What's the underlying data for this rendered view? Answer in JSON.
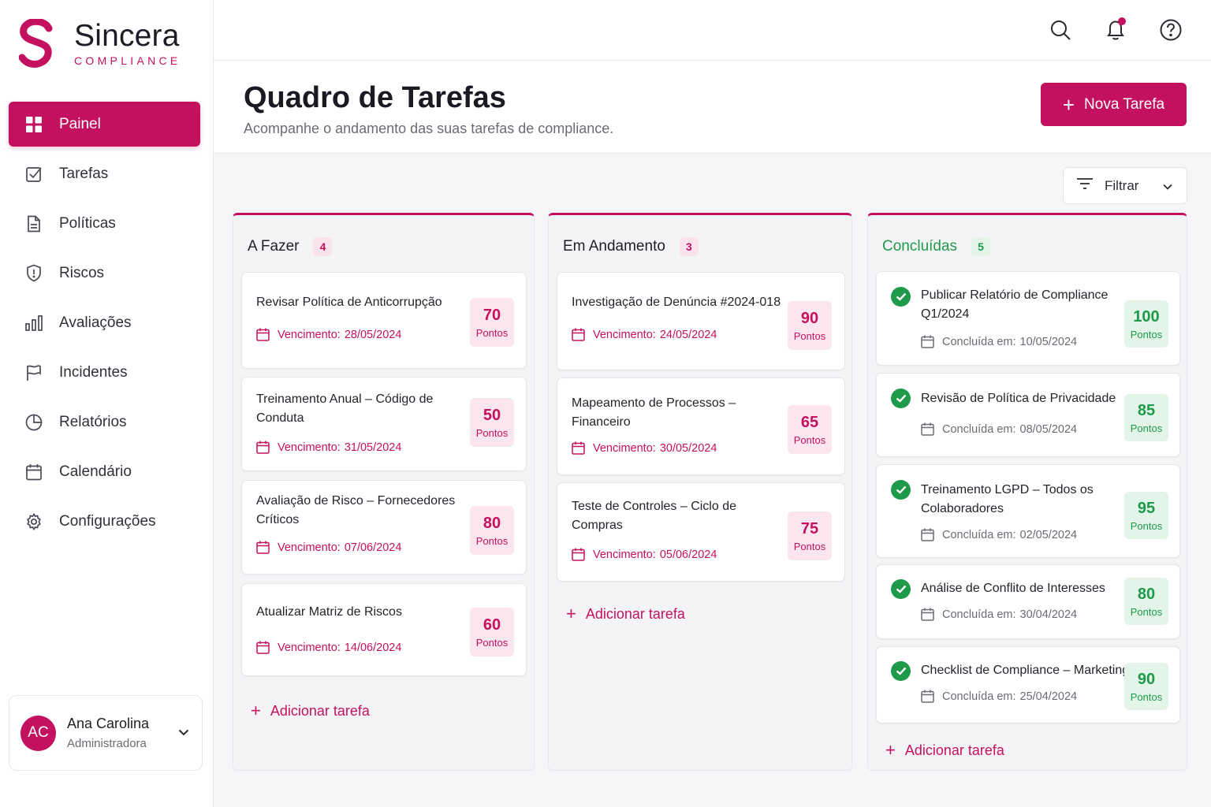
{
  "brand": {
    "name": "Sincera",
    "subtitle": "COMPLIANCE"
  },
  "nav": [
    {
      "label": "Painel",
      "icon": "dashboard-icon",
      "active": true
    },
    {
      "label": "Tarefas",
      "icon": "checkbox-icon"
    },
    {
      "label": "Políticas",
      "icon": "document-icon"
    },
    {
      "label": "Riscos",
      "icon": "shield-icon"
    },
    {
      "label": "Avaliações",
      "icon": "bar-chart-icon"
    },
    {
      "label": "Incidentes",
      "icon": "flag-icon"
    },
    {
      "label": "Relatórios",
      "icon": "pie-chart-icon"
    },
    {
      "label": "Calendário",
      "icon": "calendar-icon"
    },
    {
      "label": "Configurações",
      "icon": "gear-icon"
    }
  ],
  "user": {
    "initials": "AC",
    "name": "Ana Carolina",
    "role": "Administradora"
  },
  "header": {
    "title": "Quadro de Tarefas",
    "subtitle": "Acompanhe o andamento das suas tarefas de compliance.",
    "new_task_label": "Nova Tarefa",
    "filter_label": "Filtrar"
  },
  "colors": {
    "accent": "#c4115f",
    "success": "#1f9a4a"
  },
  "columns": [
    {
      "title": "A Fazer",
      "count": "4",
      "date_label": "Vencimento:",
      "add_label": "Adicionar tarefa",
      "cards": [
        {
          "title": "Revisar Política de Anticorrupção",
          "date": "28/05/2024",
          "points": "70",
          "points_label": "Pontos"
        },
        {
          "title": "Treinamento Anual – Código de Conduta",
          "date": "31/05/2024",
          "points": "50",
          "points_label": "Pontos"
        },
        {
          "title": "Avaliação de Risco – Fornecedores Críticos",
          "date": "07/06/2024",
          "points": "80",
          "points_label": "Pontos"
        },
        {
          "title": "Atualizar Matriz de Riscos",
          "date": "14/06/2024",
          "points": "60",
          "points_label": "Pontos"
        }
      ]
    },
    {
      "title": "Em Andamento",
      "count": "3",
      "date_label": "Vencimento:",
      "add_label": "Adicionar tarefa",
      "cards": [
        {
          "title": "Investigação de Denúncia #2024-018",
          "date": "24/05/2024",
          "points": "90",
          "points_label": "Pontos"
        },
        {
          "title": "Mapeamento de Processos – Financeiro",
          "date": "30/05/2024",
          "points": "65",
          "points_label": "Pontos"
        },
        {
          "title": "Teste de Controles – Ciclo de Compras",
          "date": "05/06/2024",
          "points": "75",
          "points_label": "Pontos"
        }
      ]
    },
    {
      "title": "Concluídas",
      "count": "5",
      "date_label": "Concluída em:",
      "add_label": "Adicionar tarefa",
      "cards": [
        {
          "title": "Publicar Relatório de Compliance Q1/2024",
          "date": "10/05/2024",
          "points": "100",
          "points_label": "Pontos"
        },
        {
          "title": "Revisão de Política de Privacidade",
          "date": "08/05/2024",
          "points": "85",
          "points_label": "Pontos"
        },
        {
          "title": "Treinamento LGPD – Todos os Colaboradores",
          "date": "02/05/2024",
          "points": "95",
          "points_label": "Pontos"
        },
        {
          "title": "Análise de Conflito de Interesses",
          "date": "30/04/2024",
          "points": "80",
          "points_label": "Pontos"
        },
        {
          "title": "Checklist de Compliance – Marketing",
          "date": "25/04/2024",
          "points": "90",
          "points_label": "Pontos"
        }
      ]
    }
  ]
}
